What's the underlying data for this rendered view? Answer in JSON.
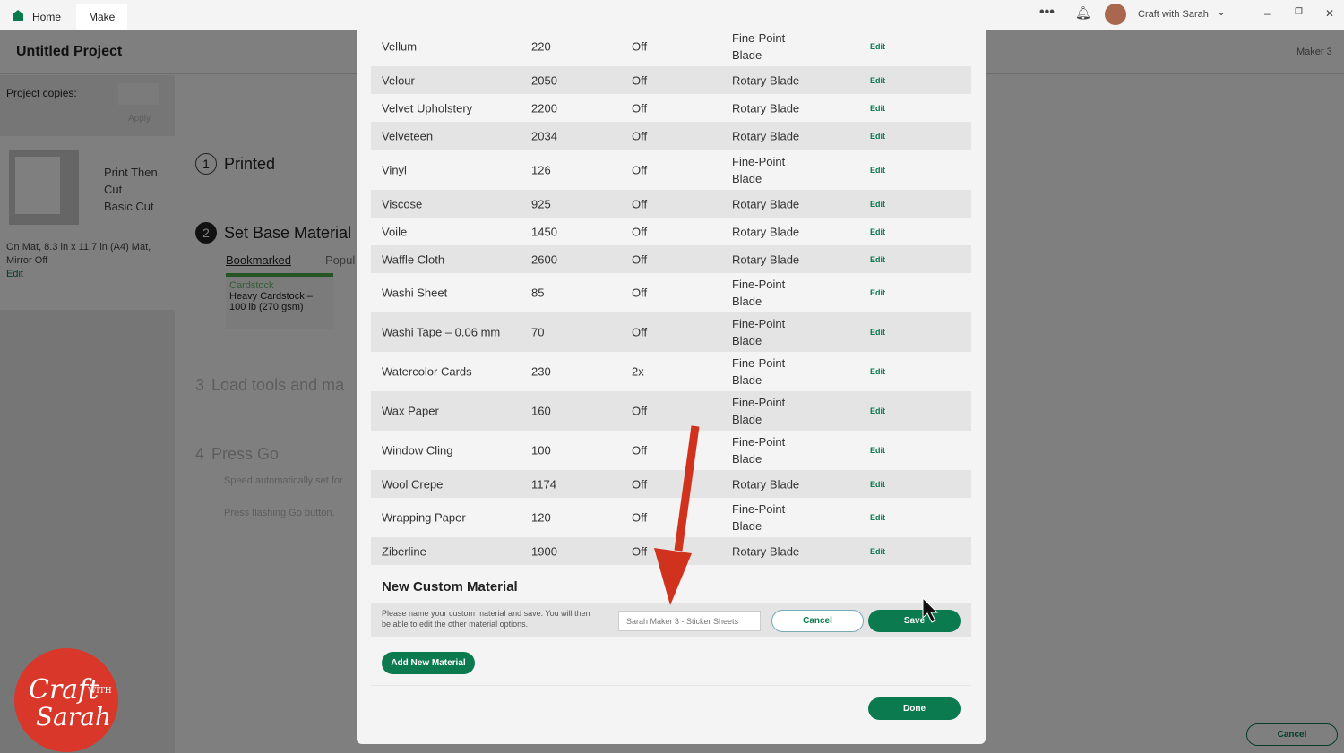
{
  "topbar": {
    "tabs": [
      {
        "label": "Home"
      },
      {
        "label": "Make"
      }
    ],
    "user": "Craft with Sarah"
  },
  "project": {
    "title": "Untitled Project",
    "machine": "Maker 3",
    "copies_label": "Project copies:",
    "apply": "Apply",
    "mat_lines": [
      "Print Then",
      "Cut",
      "Basic Cut"
    ],
    "mat_info": "On Mat, 8.3 in x 11.7 in (A4) Mat,",
    "mirror": "Mirror Off",
    "edit": "Edit"
  },
  "steps": [
    {
      "num": "1",
      "label": "Printed"
    },
    {
      "num": "2",
      "label": "Set Base Material"
    },
    {
      "num": "3",
      "label": "Load tools and ma"
    },
    {
      "num": "4",
      "label": "Press Go"
    }
  ],
  "material_tabs": [
    "Bookmarked",
    "Popul"
  ],
  "bookmark_card": {
    "category": "Cardstock",
    "name": "Heavy Cardstock –",
    "weight": "100 lb (270 gsm)"
  },
  "step4": {
    "speed": "Speed automatically set for",
    "press": "Press flashing Go button."
  },
  "footer_cancel": "Cancel",
  "materials": [
    {
      "name": "Vellum",
      "pressure": "220",
      "multi": "Off",
      "blade": "Fine-Point Blade",
      "action": "Edit"
    },
    {
      "name": "Velour",
      "pressure": "2050",
      "multi": "Off",
      "blade": "Rotary Blade",
      "action": "Edit"
    },
    {
      "name": "Velvet Upholstery",
      "pressure": "2200",
      "multi": "Off",
      "blade": "Rotary Blade",
      "action": "Edit"
    },
    {
      "name": "Velveteen",
      "pressure": "2034",
      "multi": "Off",
      "blade": "Rotary Blade",
      "action": "Edit"
    },
    {
      "name": "Vinyl",
      "pressure": "126",
      "multi": "Off",
      "blade": "Fine-Point Blade",
      "action": "Edit"
    },
    {
      "name": "Viscose",
      "pressure": "925",
      "multi": "Off",
      "blade": "Rotary Blade",
      "action": "Edit"
    },
    {
      "name": "Voile",
      "pressure": "1450",
      "multi": "Off",
      "blade": "Rotary Blade",
      "action": "Edit"
    },
    {
      "name": "Waffle Cloth",
      "pressure": "2600",
      "multi": "Off",
      "blade": "Rotary Blade",
      "action": "Edit"
    },
    {
      "name": "Washi Sheet",
      "pressure": "85",
      "multi": "Off",
      "blade": "Fine-Point Blade",
      "action": "Edit"
    },
    {
      "name": "Washi Tape – 0.06 mm",
      "pressure": "70",
      "multi": "Off",
      "blade": "Fine-Point Blade",
      "action": "Edit"
    },
    {
      "name": "Watercolor Cards",
      "pressure": "230",
      "multi": "2x",
      "blade": "Fine-Point Blade",
      "action": "Edit"
    },
    {
      "name": "Wax Paper",
      "pressure": "160",
      "multi": "Off",
      "blade": "Fine-Point Blade",
      "action": "Edit"
    },
    {
      "name": "Window Cling",
      "pressure": "100",
      "multi": "Off",
      "blade": "Fine-Point Blade",
      "action": "Edit"
    },
    {
      "name": "Wool Crepe",
      "pressure": "1174",
      "multi": "Off",
      "blade": "Rotary Blade",
      "action": "Edit"
    },
    {
      "name": "Wrapping Paper",
      "pressure": "120",
      "multi": "Off",
      "blade": "Fine-Point Blade",
      "action": "Edit"
    },
    {
      "name": "Ziberline",
      "pressure": "1900",
      "multi": "Off",
      "blade": "Rotary Blade",
      "action": "Edit"
    }
  ],
  "custom": {
    "title": "New Custom Material",
    "help": "Please name your custom material and save. You will then be able to edit the other material options.",
    "input_value": "Sarah Maker 3 - Sticker Sheets",
    "cancel": "Cancel",
    "save": "Save",
    "add": "Add New Material",
    "done": "Done"
  },
  "colors": {
    "accent": "#0b7a4f",
    "arrow": "#d0321e"
  }
}
